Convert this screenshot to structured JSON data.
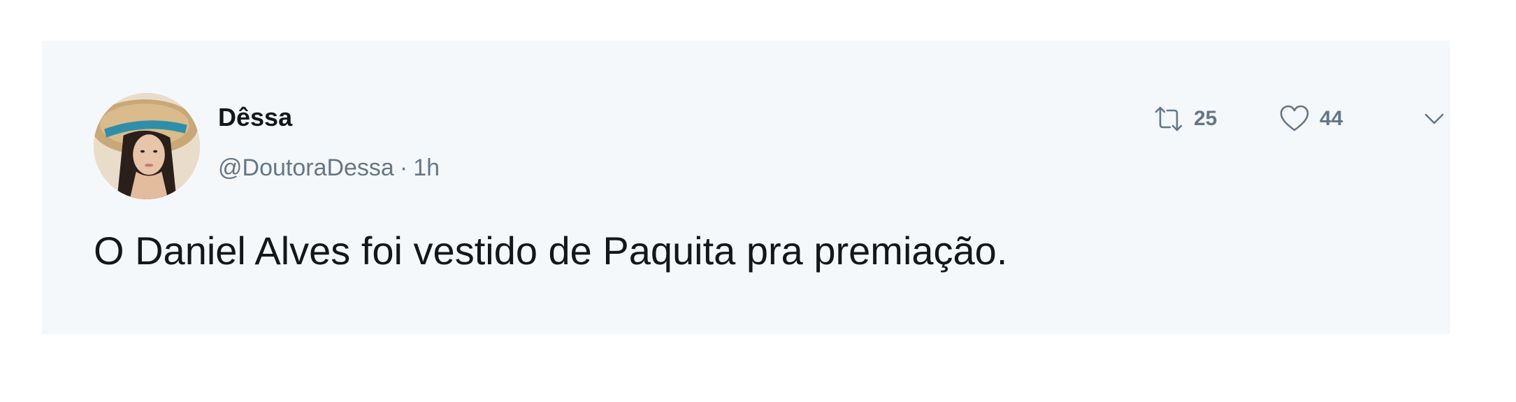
{
  "tweet": {
    "display_name": "Dêssa",
    "handle": "@DoutoraDessa",
    "separator": "·",
    "time": "1h",
    "text": "O Daniel Alves foi vestido de Paquita pra premiação.",
    "avatar_icon": "profile-photo",
    "retweet": {
      "icon": "retweet-icon",
      "count": "25"
    },
    "like": {
      "icon": "heart-icon",
      "count": "44"
    },
    "more": {
      "icon": "chevron-down-icon"
    }
  },
  "colors": {
    "card_background": "#f5f8fa",
    "primary_text": "#14171a",
    "secondary_text": "#657786"
  }
}
